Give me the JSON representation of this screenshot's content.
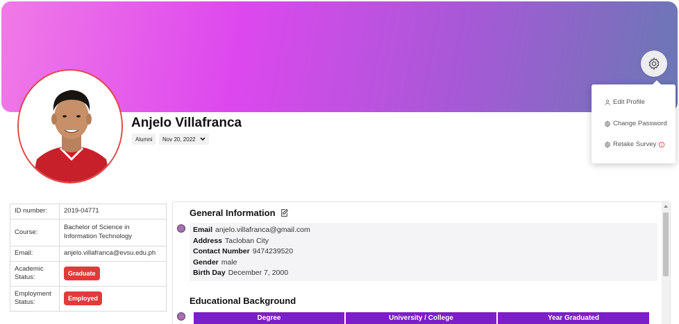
{
  "profile": {
    "name": "Anjelo Villafranca",
    "role": "Alumni",
    "date": "Nov 20, 2022"
  },
  "menu": {
    "items": [
      {
        "label": "Edit Profile",
        "icon": "user-icon"
      },
      {
        "label": "Change Password",
        "icon": "gear-icon"
      },
      {
        "label": "Retake Survey",
        "icon": "gear-icon",
        "badge_icon": "info-circle-icon"
      }
    ]
  },
  "info": {
    "id_label": "ID number:",
    "id_value": "2019-04771",
    "course_label": "Course:",
    "course_value": "Bachelor of Science in Information Technology",
    "email_label": "Email:",
    "email_value": "anjelo.villafranca@evsu.edu.ph",
    "academic_label": "Academic Status:",
    "academic_value": "Graduate",
    "employment_label": "Employment Status:",
    "employment_value": "Employed"
  },
  "general": {
    "title": "General Information",
    "rows": [
      {
        "label": "Email",
        "value": "anjelo.villafranca@gmail.com"
      },
      {
        "label": "Address",
        "value": "Tacloban City"
      },
      {
        "label": "Contact Number",
        "value": "9474239520"
      },
      {
        "label": "Gender",
        "value": "male"
      },
      {
        "label": "Birth Day",
        "value": "December 7, 2000"
      }
    ]
  },
  "education": {
    "title": "Educational Background",
    "headers": [
      "Degree",
      "University / College",
      "Year Graduated"
    ]
  },
  "colors": {
    "badge": "#e23a3a",
    "table_header": "#7b1fc9",
    "timeline_dot": "#a86fb1"
  }
}
